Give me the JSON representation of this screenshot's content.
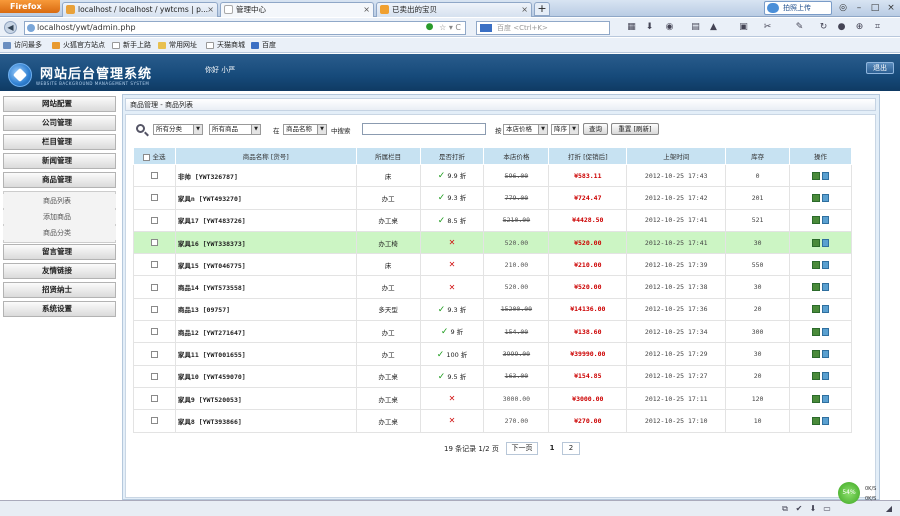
{
  "browser": {
    "brand": "Firefox",
    "tabs": [
      {
        "label": "localhost / localhost / ywtcms | p...",
        "active": false,
        "icon_color": "#e8a13a"
      },
      {
        "label": "管理中心",
        "active": true,
        "icon_color": "#ffffff"
      },
      {
        "label": "已卖出的宝贝",
        "active": false,
        "icon_color": "#f0a030"
      }
    ],
    "new_tab": "+",
    "upload_label": "拍照上传",
    "url": "localhost/ywt/admin.php",
    "search_placeholder": "百度 <Ctrl+K>",
    "bookmarks": [
      "访问最多",
      "火狐官方站点",
      "新手上路",
      "常用网址",
      "天猫商城",
      "百度"
    ]
  },
  "header": {
    "title": "网站后台管理系统",
    "subtitle": "WEBSITE BACKGROUND MANAGEMENT SYSTEM",
    "greeting": "你好 小严",
    "logout": "退出"
  },
  "sidebar": {
    "items": [
      "网站配置",
      "公司管理",
      "栏目管理",
      "新闻管理",
      "商品管理"
    ],
    "sub_items": [
      "商品列表",
      "添加商品",
      "商品分类"
    ],
    "items_after": [
      "留言管理",
      "友情链接",
      "招贤纳士",
      "系统设置"
    ]
  },
  "breadcrumb": "商品管理 - 商品列表",
  "filter": {
    "category_select": "所有分类",
    "product_select": "所有商品",
    "in_label": "在",
    "field_select": "商品名称",
    "search_label": "中搜索",
    "sort_label": "按",
    "sort_select": "本店价格",
    "order_select": "降序",
    "query_button": "查询",
    "reset_button": "重置 [刷新]"
  },
  "table": {
    "headers": [
      "全选",
      "商品名称 [货号]",
      "所属栏目",
      "是否打折",
      "本店价格",
      "打折 [促销后]",
      "上架时间",
      "库存",
      "操作"
    ],
    "rows": [
      {
        "name": "非帅 [YWT326787]",
        "category": "床",
        "discount": true,
        "rate": "9.9 折",
        "price": "596.00",
        "strike": true,
        "new_price": "¥583.11",
        "date": "2012-10-25 17:43",
        "stock": "0",
        "highlight": false
      },
      {
        "name": "家具n [YWT493270]",
        "category": "办工",
        "discount": true,
        "rate": "9.3 折",
        "price": "779.00",
        "strike": true,
        "new_price": "¥724.47",
        "date": "2012-10-25 17:42",
        "stock": "201",
        "highlight": false
      },
      {
        "name": "家具17 [YWT483726]",
        "category": "办工桌",
        "discount": true,
        "rate": "8.5 折",
        "price": "5210.00",
        "strike": true,
        "new_price": "¥4428.50",
        "date": "2012-10-25 17:41",
        "stock": "521",
        "highlight": false
      },
      {
        "name": "家具16 [YWT338373]",
        "category": "办工椅",
        "discount": false,
        "rate": "",
        "price": "520.00",
        "strike": false,
        "new_price": "¥520.00",
        "date": "2012-10-25 17:41",
        "stock": "30",
        "highlight": true
      },
      {
        "name": "家具15 [YWT046775]",
        "category": "床",
        "discount": false,
        "rate": "",
        "price": "210.00",
        "strike": false,
        "new_price": "¥210.00",
        "date": "2012-10-25 17:39",
        "stock": "550",
        "highlight": false
      },
      {
        "name": "商品14 [YWT573558]",
        "category": "办工",
        "discount": false,
        "rate": "",
        "price": "520.00",
        "strike": false,
        "new_price": "¥520.00",
        "date": "2012-10-25 17:38",
        "stock": "30",
        "highlight": false
      },
      {
        "name": "商品13 [09757]",
        "category": "多天型",
        "discount": true,
        "rate": "9.3 折",
        "price": "15200.00",
        "strike": true,
        "new_price": "¥14136.00",
        "date": "2012-10-25 17:36",
        "stock": "20",
        "highlight": false
      },
      {
        "name": "商品12 [YWT271647]",
        "category": "办工",
        "discount": true,
        "rate": "9 折",
        "price": "154.00",
        "strike": true,
        "new_price": "¥138.60",
        "date": "2012-10-25 17:34",
        "stock": "300",
        "highlight": false
      },
      {
        "name": "家具11 [YWT001655]",
        "category": "办工",
        "discount": true,
        "rate": "100 折",
        "price": "3999.00",
        "strike": true,
        "new_price": "¥39990.00",
        "date": "2012-10-25 17:29",
        "stock": "30",
        "highlight": false
      },
      {
        "name": "家具10 [YWT459070]",
        "category": "办工桌",
        "discount": true,
        "rate": "9.5 折",
        "price": "163.00",
        "strike": true,
        "new_price": "¥154.85",
        "date": "2012-10-25 17:27",
        "stock": "20",
        "highlight": false
      },
      {
        "name": "家具9 [YWT520053]",
        "category": "办工桌",
        "discount": false,
        "rate": "",
        "price": "3000.00",
        "strike": false,
        "new_price": "¥3000.00",
        "date": "2012-10-25 17:11",
        "stock": "120",
        "highlight": false
      },
      {
        "name": "家具8 [YWT393866]",
        "category": "办工桌",
        "discount": false,
        "rate": "",
        "price": "270.00",
        "strike": false,
        "new_price": "¥270.00",
        "date": "2012-10-25 17:10",
        "stock": "10",
        "highlight": false
      }
    ]
  },
  "pager": {
    "summary": "19 条记录 1/2 页",
    "next": "下一页",
    "pages": [
      "1",
      "2"
    ]
  },
  "statusbar": {
    "net_percent": "54%",
    "up_speed": "0K/S",
    "down_speed": "0K/S"
  },
  "colors": {
    "header_bg": "#164a7a",
    "table_header_bg": "#c7e2f2",
    "highlight_row": "#ccf5c4",
    "price_red": "#cc0000",
    "check_green": "#1a9a1a"
  }
}
